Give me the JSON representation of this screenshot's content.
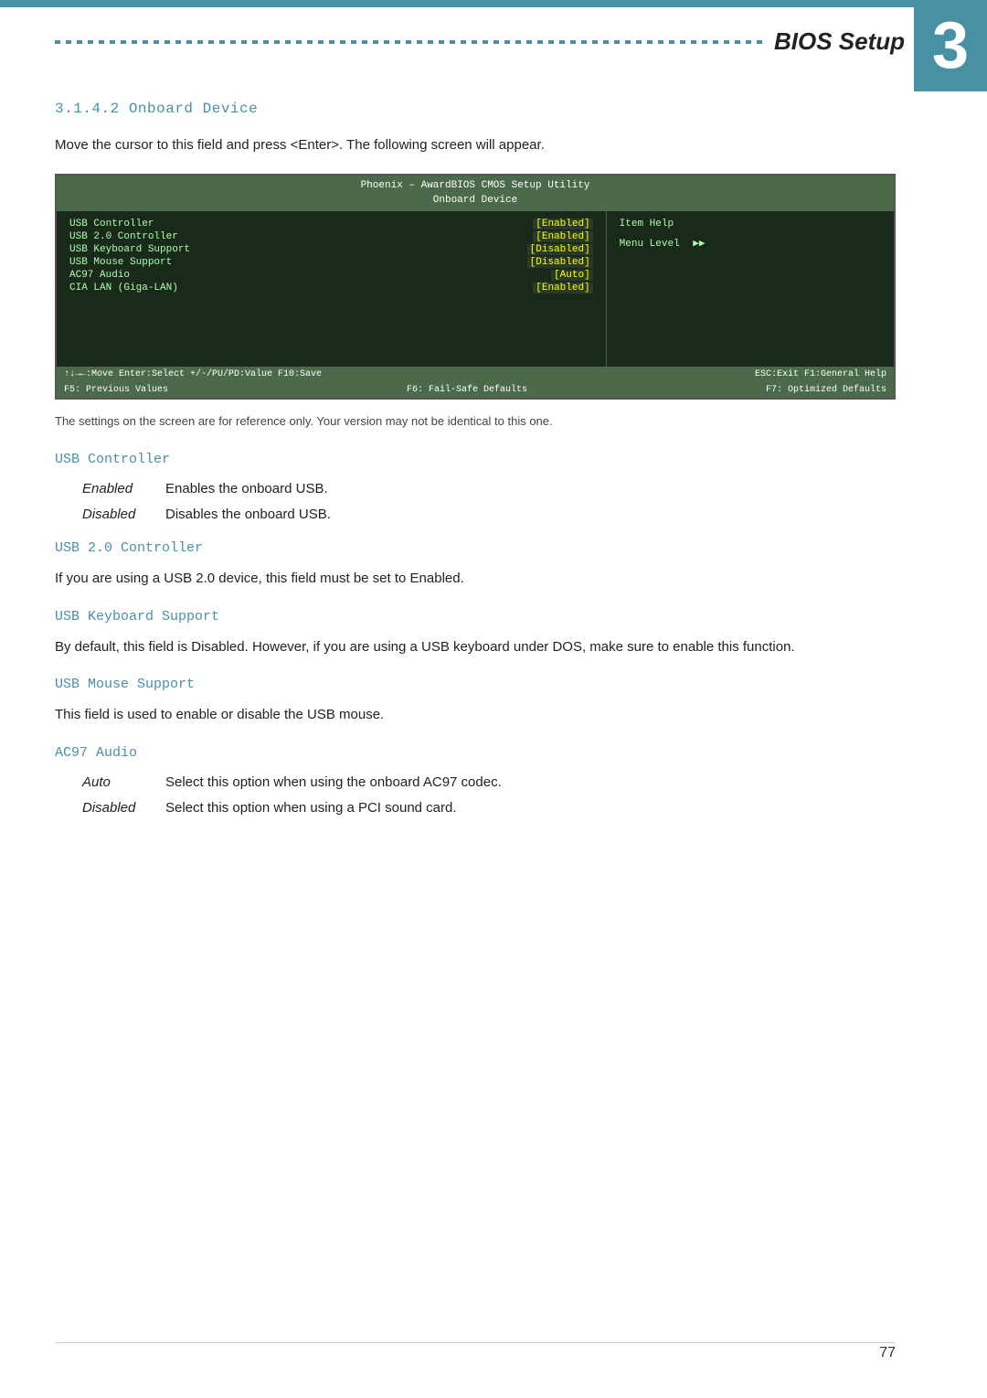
{
  "page": {
    "chapter_number": "3",
    "bios_setup_label": "BIOS Setup",
    "section_heading": "3.1.4.2   Onboard Device",
    "intro_para": "Move the cursor to this field and press <Enter>. The following screen will appear.",
    "reference_note": "The settings on the screen are for reference only. Your version may not be identical to this one.",
    "bios_screen": {
      "title_line1": "Phoenix – AwardBIOS CMOS Setup Utility",
      "title_line2": "Onboard Device",
      "rows": [
        {
          "key": "USB Controller",
          "val": "[Enabled]"
        },
        {
          "key": "USB 2.0 Controller",
          "val": "[Enabled]"
        },
        {
          "key": "USB Keyboard Support",
          "val": "[Disabled]"
        },
        {
          "key": "USB Mouse Support",
          "val": "[Disabled]"
        },
        {
          "key": "AC97 Audio",
          "val": "[Auto]"
        },
        {
          "key": "CIA LAN (Giga-LAN)",
          "val": "[Enabled]"
        }
      ],
      "item_help_label": "Item Help",
      "menu_level_label": "Menu Level",
      "menu_level_arrows": "▶▶",
      "bottom_left": "↑↓→←:Move  Enter:Select  +/-/PU/PD:Value  F10:Save",
      "bottom_right": "ESC:Exit  F1:General Help  F5: Previous Values  F6: Fail-Safe Defaults  F7: Optimized Defaults"
    },
    "sections": [
      {
        "id": "usb-controller",
        "heading": "USB Controller",
        "type": "definitions",
        "definitions": [
          {
            "term": "Enabled",
            "desc": "Enables the onboard USB."
          },
          {
            "term": "Disabled",
            "desc": "Disables the onboard USB."
          }
        ]
      },
      {
        "id": "usb-20-controller",
        "heading": "USB 2.0 Controller",
        "type": "paragraph",
        "text": "If you are using a USB 2.0 device, this field must be set to Enabled."
      },
      {
        "id": "usb-keyboard-support",
        "heading": "USB Keyboard Support",
        "type": "paragraph",
        "text": "By default, this field is Disabled. However, if you are using a USB keyboard under DOS, make sure to enable this function."
      },
      {
        "id": "usb-mouse-support",
        "heading": "USB Mouse Support",
        "type": "paragraph",
        "text": "This field is used to enable or disable the USB mouse."
      },
      {
        "id": "ac97-audio",
        "heading": "AC97 Audio",
        "type": "definitions",
        "definitions": [
          {
            "term": "Auto",
            "desc": "Select this option when using the onboard AC97 codec."
          },
          {
            "term": "Disabled",
            "desc": "Select this option when using a PCI sound card."
          }
        ]
      }
    ],
    "page_number": "77"
  }
}
